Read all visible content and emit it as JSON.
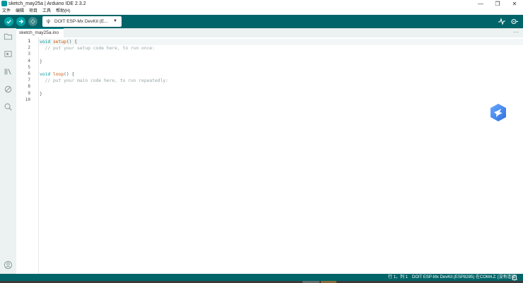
{
  "window": {
    "title": "sketch_may25a | Arduino IDE 2.3.2",
    "controls": [
      "—",
      "❐",
      "✕"
    ]
  },
  "menu": [
    "文件",
    "编辑",
    "项目",
    "工具",
    "帮助(H)"
  ],
  "toolbar": {
    "board_selector": "DOIT ESP-Mx DevKit (E..."
  },
  "tabs": [
    {
      "label": "sketch_may25a.ino",
      "active": true
    }
  ],
  "tab_more": "···",
  "editor": {
    "line_numbers": [
      "1",
      "2",
      "3",
      "4",
      "5",
      "6",
      "7",
      "8",
      "9",
      "10"
    ],
    "lines": [
      [
        {
          "t": "void",
          "c": "kw"
        },
        {
          "t": " "
        },
        {
          "t": "setup",
          "c": "fn"
        },
        {
          "t": "() {"
        }
      ],
      [
        {
          "t": "  // put your setup code here, to run once:",
          "c": "cm"
        }
      ],
      [],
      [
        {
          "t": "}"
        }
      ],
      [],
      [
        {
          "t": "void",
          "c": "kw"
        },
        {
          "t": " "
        },
        {
          "t": "loop",
          "c": "fn"
        },
        {
          "t": "() {"
        }
      ],
      [
        {
          "t": "  // put your main code here, to run repeatedly:",
          "c": "cm"
        }
      ],
      [],
      [
        {
          "t": "}"
        }
      ],
      []
    ]
  },
  "status": {
    "position": "行 1，列 1",
    "board": "DOIT ESP-Mx DevKit (ESP8285) 在COM4上 [没有连接]",
    "bell_icon": "bell-icon"
  },
  "colors": {
    "toolbar_bg": "#006468",
    "accent": "#00979c",
    "status_bg": "#006468"
  }
}
